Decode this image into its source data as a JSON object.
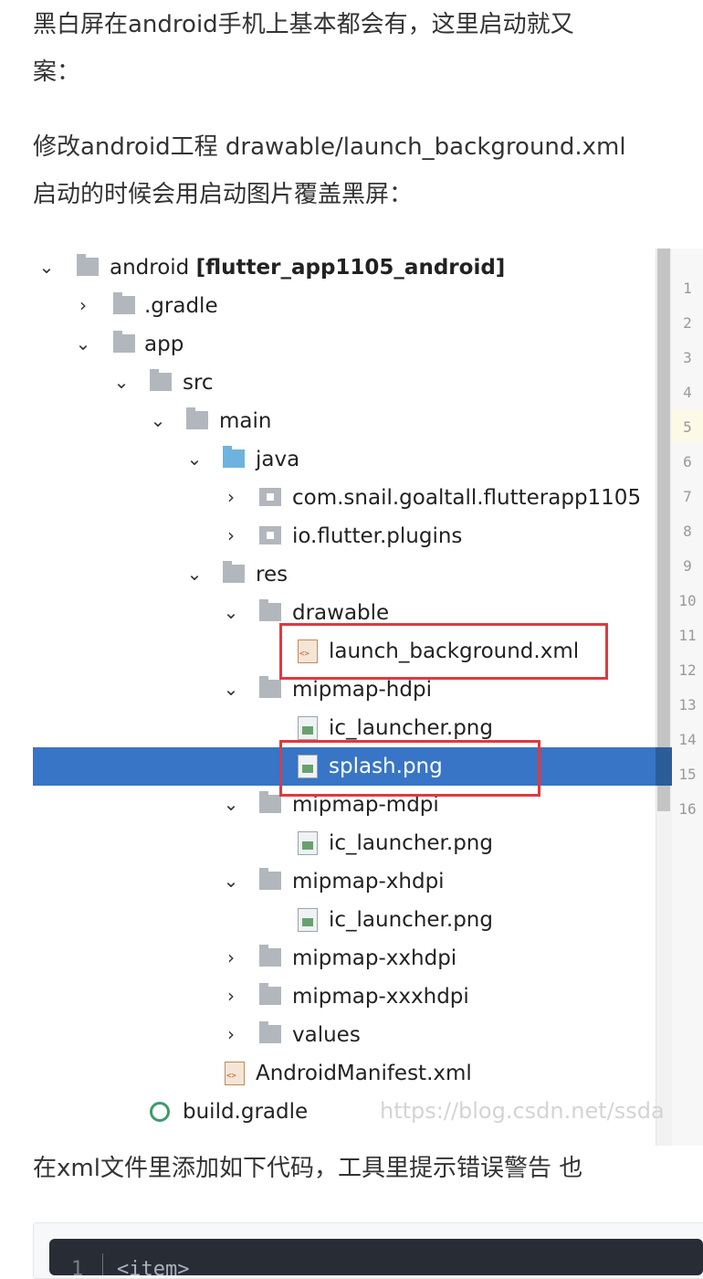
{
  "article": {
    "para1_line1": "黑白屏在android手机上基本都会有，这里启动就又",
    "para1_line2": "案：",
    "para2_line1": "修改android工程 drawable/launch_background.xml",
    "para2_line2": "启动的时候会用启动图片覆盖黑屏：",
    "para3": "在xml文件里添加如下代码，工具里提示错误警告 也"
  },
  "tree": {
    "root_name": "android",
    "root_module": "[flutter_app1105_android]",
    "items": [
      {
        "label": "android",
        "icon": "module-folder-icon"
      },
      {
        "label": ".gradle",
        "icon": "folder-icon"
      },
      {
        "label": "app",
        "icon": "folder-icon"
      },
      {
        "label": "src",
        "icon": "folder-icon"
      },
      {
        "label": "main",
        "icon": "folder-icon"
      },
      {
        "label": "java",
        "icon": "source-folder-icon"
      },
      {
        "label": "com.snail.goaltall.flutterapp1105",
        "icon": "package-icon"
      },
      {
        "label": "io.flutter.plugins",
        "icon": "package-icon"
      },
      {
        "label": "res",
        "icon": "folder-icon"
      },
      {
        "label": "drawable",
        "icon": "folder-icon"
      },
      {
        "label": "launch_background.xml",
        "icon": "xml-file-icon"
      },
      {
        "label": "mipmap-hdpi",
        "icon": "folder-icon"
      },
      {
        "label": "ic_launcher.png",
        "icon": "image-file-icon"
      },
      {
        "label": "splash.png",
        "icon": "image-file-icon"
      },
      {
        "label": "mipmap-mdpi",
        "icon": "folder-icon"
      },
      {
        "label": "ic_launcher.png",
        "icon": "image-file-icon"
      },
      {
        "label": "mipmap-xhdpi",
        "icon": "folder-icon"
      },
      {
        "label": "ic_launcher.png",
        "icon": "image-file-icon"
      },
      {
        "label": "mipmap-xxhdpi",
        "icon": "folder-icon"
      },
      {
        "label": "mipmap-xxxhdpi",
        "icon": "folder-icon"
      },
      {
        "label": "values",
        "icon": "folder-icon"
      },
      {
        "label": "AndroidManifest.xml",
        "icon": "manifest-file-icon"
      },
      {
        "label": "build.gradle",
        "icon": "gradle-file-icon"
      }
    ],
    "selected_item": "splash.png"
  },
  "gutter": {
    "line_numbers": [
      "1",
      "2",
      "3",
      "4",
      "5",
      "6",
      "7",
      "8",
      "9",
      "10",
      "11",
      "12",
      "13",
      "14",
      "15",
      "16"
    ],
    "current_line": "5"
  },
  "watermark": "https://blog.csdn.net/ssda",
  "code": {
    "line_number": "1",
    "text": "<item>"
  },
  "colors": {
    "selection": "#3875c6",
    "highlight_box": "#e0393e",
    "code_background": "#282c34"
  }
}
